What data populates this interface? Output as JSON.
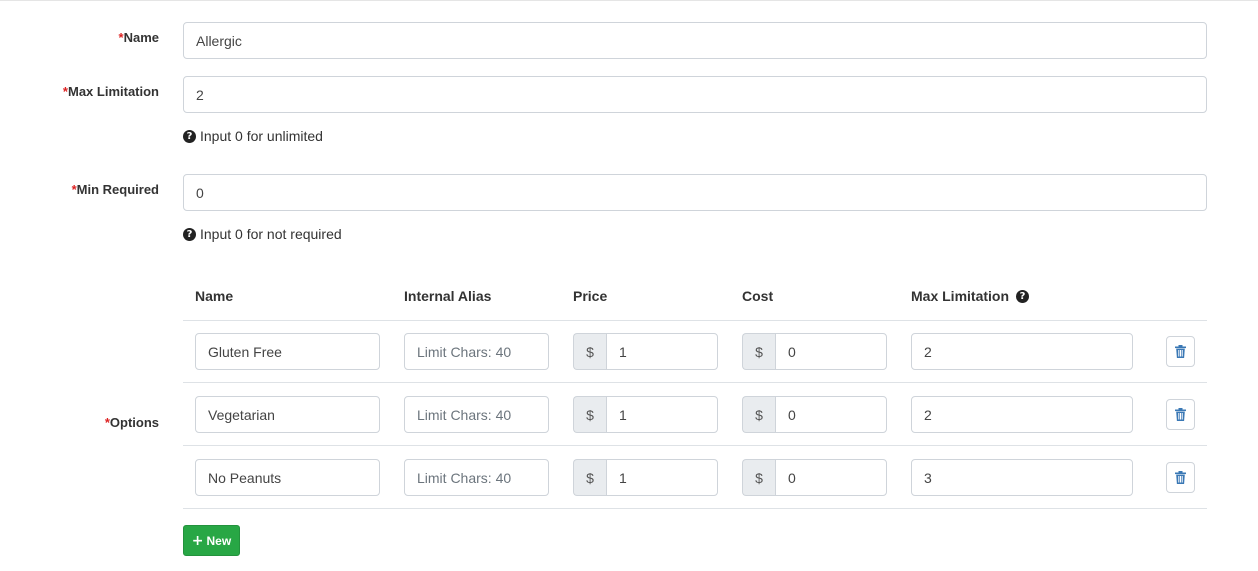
{
  "form": {
    "name": {
      "required_mark": "*",
      "label": "Name",
      "value": "Allergic"
    },
    "max_limitation": {
      "required_mark": "*",
      "label": "Max Limitation",
      "value": "2",
      "help": "Input 0 for unlimited"
    },
    "min_required": {
      "required_mark": "*",
      "label": "Min Required",
      "value": "0",
      "help": "Input 0 for not required"
    },
    "options": {
      "required_mark": "*",
      "label": "Options",
      "headers": {
        "name": "Name",
        "alias": "Internal Alias",
        "price": "Price",
        "cost": "Cost",
        "max": "Max Limitation"
      },
      "currency": "$",
      "alias_placeholder": "Limit Chars: 40",
      "rows": [
        {
          "name": "Gluten Free",
          "alias": "",
          "price": "1",
          "cost": "0",
          "max": "2"
        },
        {
          "name": "Vegetarian",
          "alias": "",
          "price": "1",
          "cost": "0",
          "max": "2"
        },
        {
          "name": "No Peanuts",
          "alias": "",
          "price": "1",
          "cost": "0",
          "max": "3"
        }
      ]
    },
    "new_button": {
      "icon": "plus-icon",
      "label": "New"
    }
  },
  "colors": {
    "required": "#dd2222",
    "new_button": "#28a745",
    "delete_icon": "#3a78b5"
  }
}
